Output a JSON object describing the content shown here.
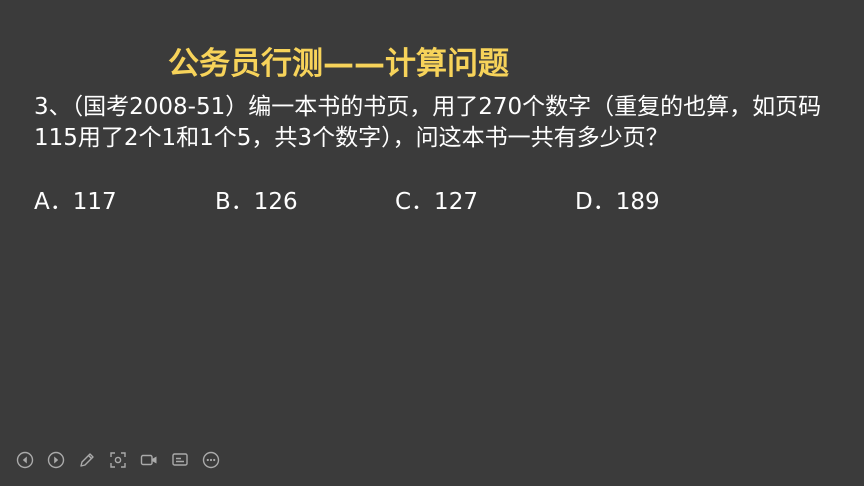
{
  "slide": {
    "title": "公务员行测——计算问题",
    "question": "3、（国考2008-51）编一本书的书页，用了270个数字（重复的也算，如页码115用了2个1和1个5，共3个数字），问这本书一共有多少页？",
    "options": [
      {
        "label": "A．117"
      },
      {
        "label": "B．126"
      },
      {
        "label": "C．127"
      },
      {
        "label": "D．189"
      }
    ]
  },
  "toolbar": {
    "buttons": [
      {
        "icon": "previous-icon"
      },
      {
        "icon": "next-icon"
      },
      {
        "icon": "pen-icon"
      },
      {
        "icon": "zoom-icon"
      },
      {
        "icon": "camera-icon"
      },
      {
        "icon": "subtitle-icon"
      },
      {
        "icon": "more-icon"
      }
    ]
  },
  "colors": {
    "background": "#3b3b3b",
    "title": "#f7d35a",
    "text": "#ffffff"
  }
}
